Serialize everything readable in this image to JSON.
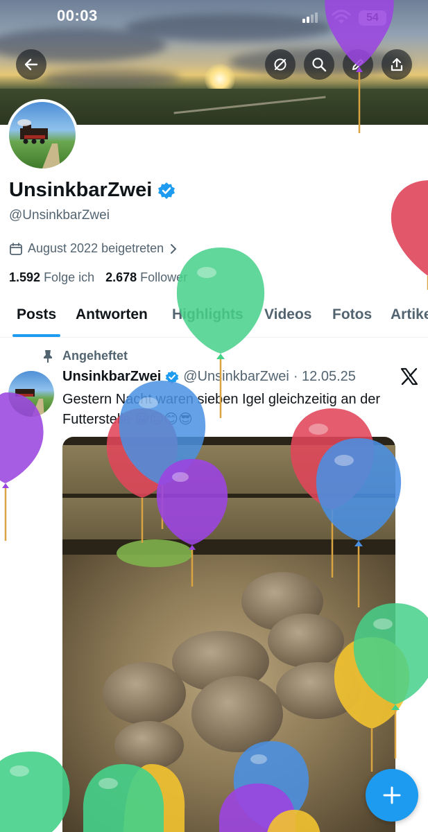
{
  "status_bar": {
    "time": "00:03",
    "battery": "54"
  },
  "profile": {
    "display_name": "UnsinkbarZwei",
    "handle": "@UnsinkbarZwei",
    "joined": "August 2022 beigetreten",
    "following_count": "1.592",
    "following_label": "Folge ich",
    "followers_count": "2.678",
    "followers_label": "Follower"
  },
  "tabs": [
    {
      "label": "Posts",
      "active": true
    },
    {
      "label": "Antworten"
    },
    {
      "label": "Highlights"
    },
    {
      "label": "Videos"
    },
    {
      "label": "Fotos"
    },
    {
      "label": "Artike"
    }
  ],
  "pinned_post": {
    "pinned_label": "Angeheftet",
    "author": "UnsinkbarZwei",
    "handle": "@UnsinkbarZwei",
    "date": "· 12.05.25",
    "text": "Gestern Nacht waren sieben Igel gleichzeitig an der Futterstelle 😀😐😊😎"
  },
  "colors": {
    "accent": "#1d9bf0",
    "verified": "#1d9bf0"
  },
  "icons": [
    "back-arrow-icon",
    "grok-icon",
    "search-icon",
    "edit-icon",
    "share-icon",
    "calendar-icon",
    "chevron-right-icon",
    "pin-icon",
    "verified-badge-icon",
    "x-logo-icon",
    "plus-icon"
  ]
}
